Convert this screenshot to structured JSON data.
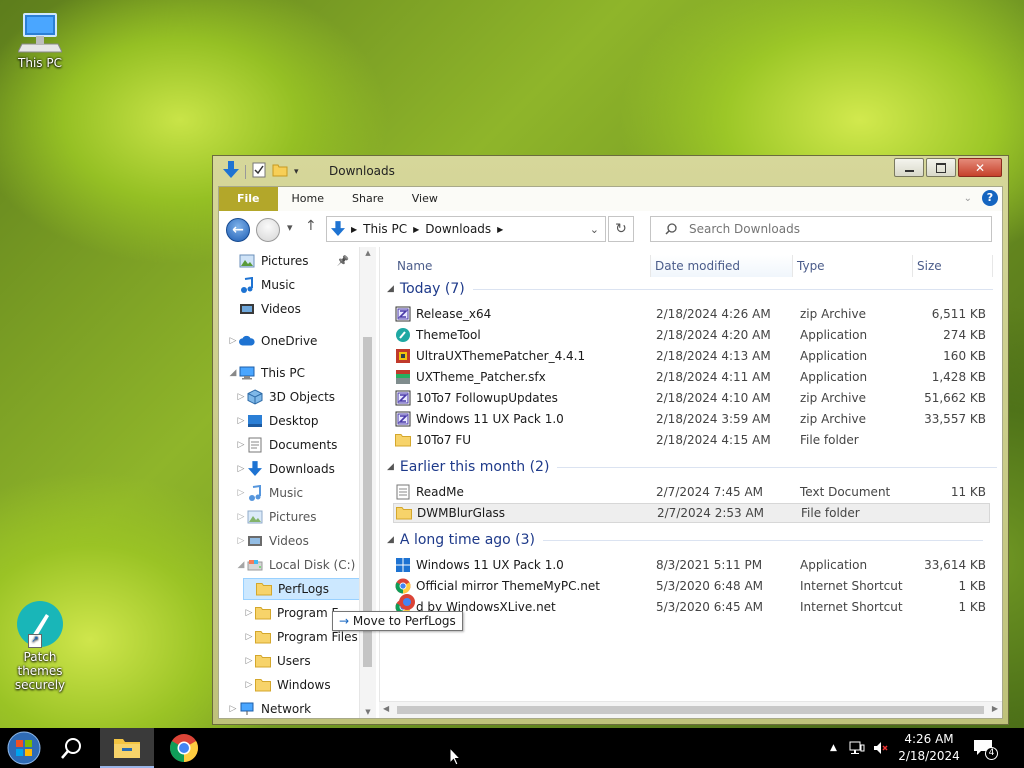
{
  "desktop": {
    "icons": [
      {
        "label": "This PC",
        "icon": "computer-icon"
      },
      {
        "label": "Patch themes securely",
        "line1": "Patch themes",
        "line2": "securely",
        "icon": "brush-icon"
      }
    ]
  },
  "window": {
    "title": "Downloads",
    "controls": {
      "minimize": "minimize",
      "maximize": "maximize",
      "close": "close"
    },
    "ribbon_tabs": [
      "File",
      "Home",
      "Share",
      "View"
    ],
    "address": {
      "segments": [
        "This PC",
        "Downloads"
      ]
    },
    "search": {
      "placeholder": "Search Downloads"
    },
    "nav": [
      {
        "label": "Pictures",
        "icon": "pictures-icon",
        "pinned": true
      },
      {
        "label": "Music",
        "icon": "music-icon"
      },
      {
        "label": "Videos",
        "icon": "videos-icon"
      },
      {
        "label": "OneDrive",
        "icon": "cloud-icon"
      },
      {
        "label": "This PC",
        "icon": "computer-icon"
      },
      {
        "label": "3D Objects",
        "icon": "cube-icon"
      },
      {
        "label": "Desktop",
        "icon": "desktop-icon"
      },
      {
        "label": "Documents",
        "icon": "documents-icon"
      },
      {
        "label": "Downloads",
        "icon": "download-icon"
      },
      {
        "label": "Music",
        "icon": "music-icon"
      },
      {
        "label": "Pictures",
        "icon": "pictures-icon"
      },
      {
        "label": "Videos",
        "icon": "videos-icon"
      },
      {
        "label": "Local Disk (C:)",
        "icon": "drive-icon"
      },
      {
        "label": "PerfLogs",
        "icon": "folder-icon"
      },
      {
        "label": "Program F",
        "icon": "folder-icon"
      },
      {
        "label": "Program Files (",
        "icon": "folder-icon"
      },
      {
        "label": "Users",
        "icon": "folder-icon"
      },
      {
        "label": "Windows",
        "icon": "folder-icon"
      },
      {
        "label": "Network",
        "icon": "network-icon"
      }
    ],
    "columns": [
      "Name",
      "Date modified",
      "Type",
      "Size"
    ],
    "groups": [
      {
        "label": "Today (7)",
        "files": [
          {
            "name": "Release_x64",
            "date": "2/18/2024 4:26 AM",
            "type": "zip Archive",
            "size": "6,511 KB",
            "icon": "zip-icon"
          },
          {
            "name": "ThemeTool",
            "date": "2/18/2024 4:20 AM",
            "type": "Application",
            "size": "274 KB",
            "icon": "app-icon"
          },
          {
            "name": "UltraUXThemePatcher_4.4.1",
            "date": "2/18/2024 4:13 AM",
            "type": "Application",
            "size": "160 KB",
            "icon": "installer-icon"
          },
          {
            "name": "UXTheme_Patcher.sfx",
            "date": "2/18/2024 4:11 AM",
            "type": "Application",
            "size": "1,428 KB",
            "icon": "sfx-icon"
          },
          {
            "name": "10To7 FollowupUpdates",
            "date": "2/18/2024 4:10 AM",
            "type": "zip Archive",
            "size": "51,662 KB",
            "icon": "zip-icon"
          },
          {
            "name": "Windows 11 UX Pack 1.0",
            "date": "2/18/2024 3:59 AM",
            "type": "zip Archive",
            "size": "33,557 KB",
            "icon": "zip-icon"
          },
          {
            "name": "10To7 FU",
            "date": "2/18/2024 4:15 AM",
            "type": "File folder",
            "size": "",
            "icon": "folder-icon"
          }
        ]
      },
      {
        "label": "Earlier this month (2)",
        "files": [
          {
            "name": "ReadMe",
            "date": "2/7/2024 7:45 AM",
            "type": "Text Document",
            "size": "11 KB",
            "icon": "text-icon"
          },
          {
            "name": "DWMBlurGlass",
            "date": "2/7/2024 2:53 AM",
            "type": "File folder",
            "size": "",
            "icon": "folder-icon",
            "selected": true
          }
        ]
      },
      {
        "label": "A long time ago (3)",
        "files": [
          {
            "name": "Windows 11 UX Pack 1.0",
            "date": "8/3/2021 5:11 PM",
            "type": "Application",
            "size": "33,614 KB",
            "icon": "windows-icon"
          },
          {
            "name": "Official mirror ThemeMyPC.net",
            "date": "5/3/2020 6:48 AM",
            "type": "Internet Shortcut",
            "size": "1 KB",
            "icon": "chrome-icon"
          },
          {
            "name": "d by WindowsXLive.net",
            "date": "5/3/2020 6:45 AM",
            "type": "Internet Shortcut",
            "size": "1 KB",
            "icon": "chrome-icon"
          }
        ]
      }
    ],
    "drag": {
      "tooltip": "Move to PerfLogs"
    }
  },
  "taskbar": {
    "items": [
      "start-icon",
      "search-icon",
      "file-explorer-icon",
      "chrome-icon"
    ],
    "time": "4:26 AM",
    "date": "2/18/2024",
    "notifications": "4"
  },
  "colors": {
    "file_tab": "#b3a72a",
    "accent_blue": "#1e3a8a",
    "window_frame": "#cfd08f"
  }
}
